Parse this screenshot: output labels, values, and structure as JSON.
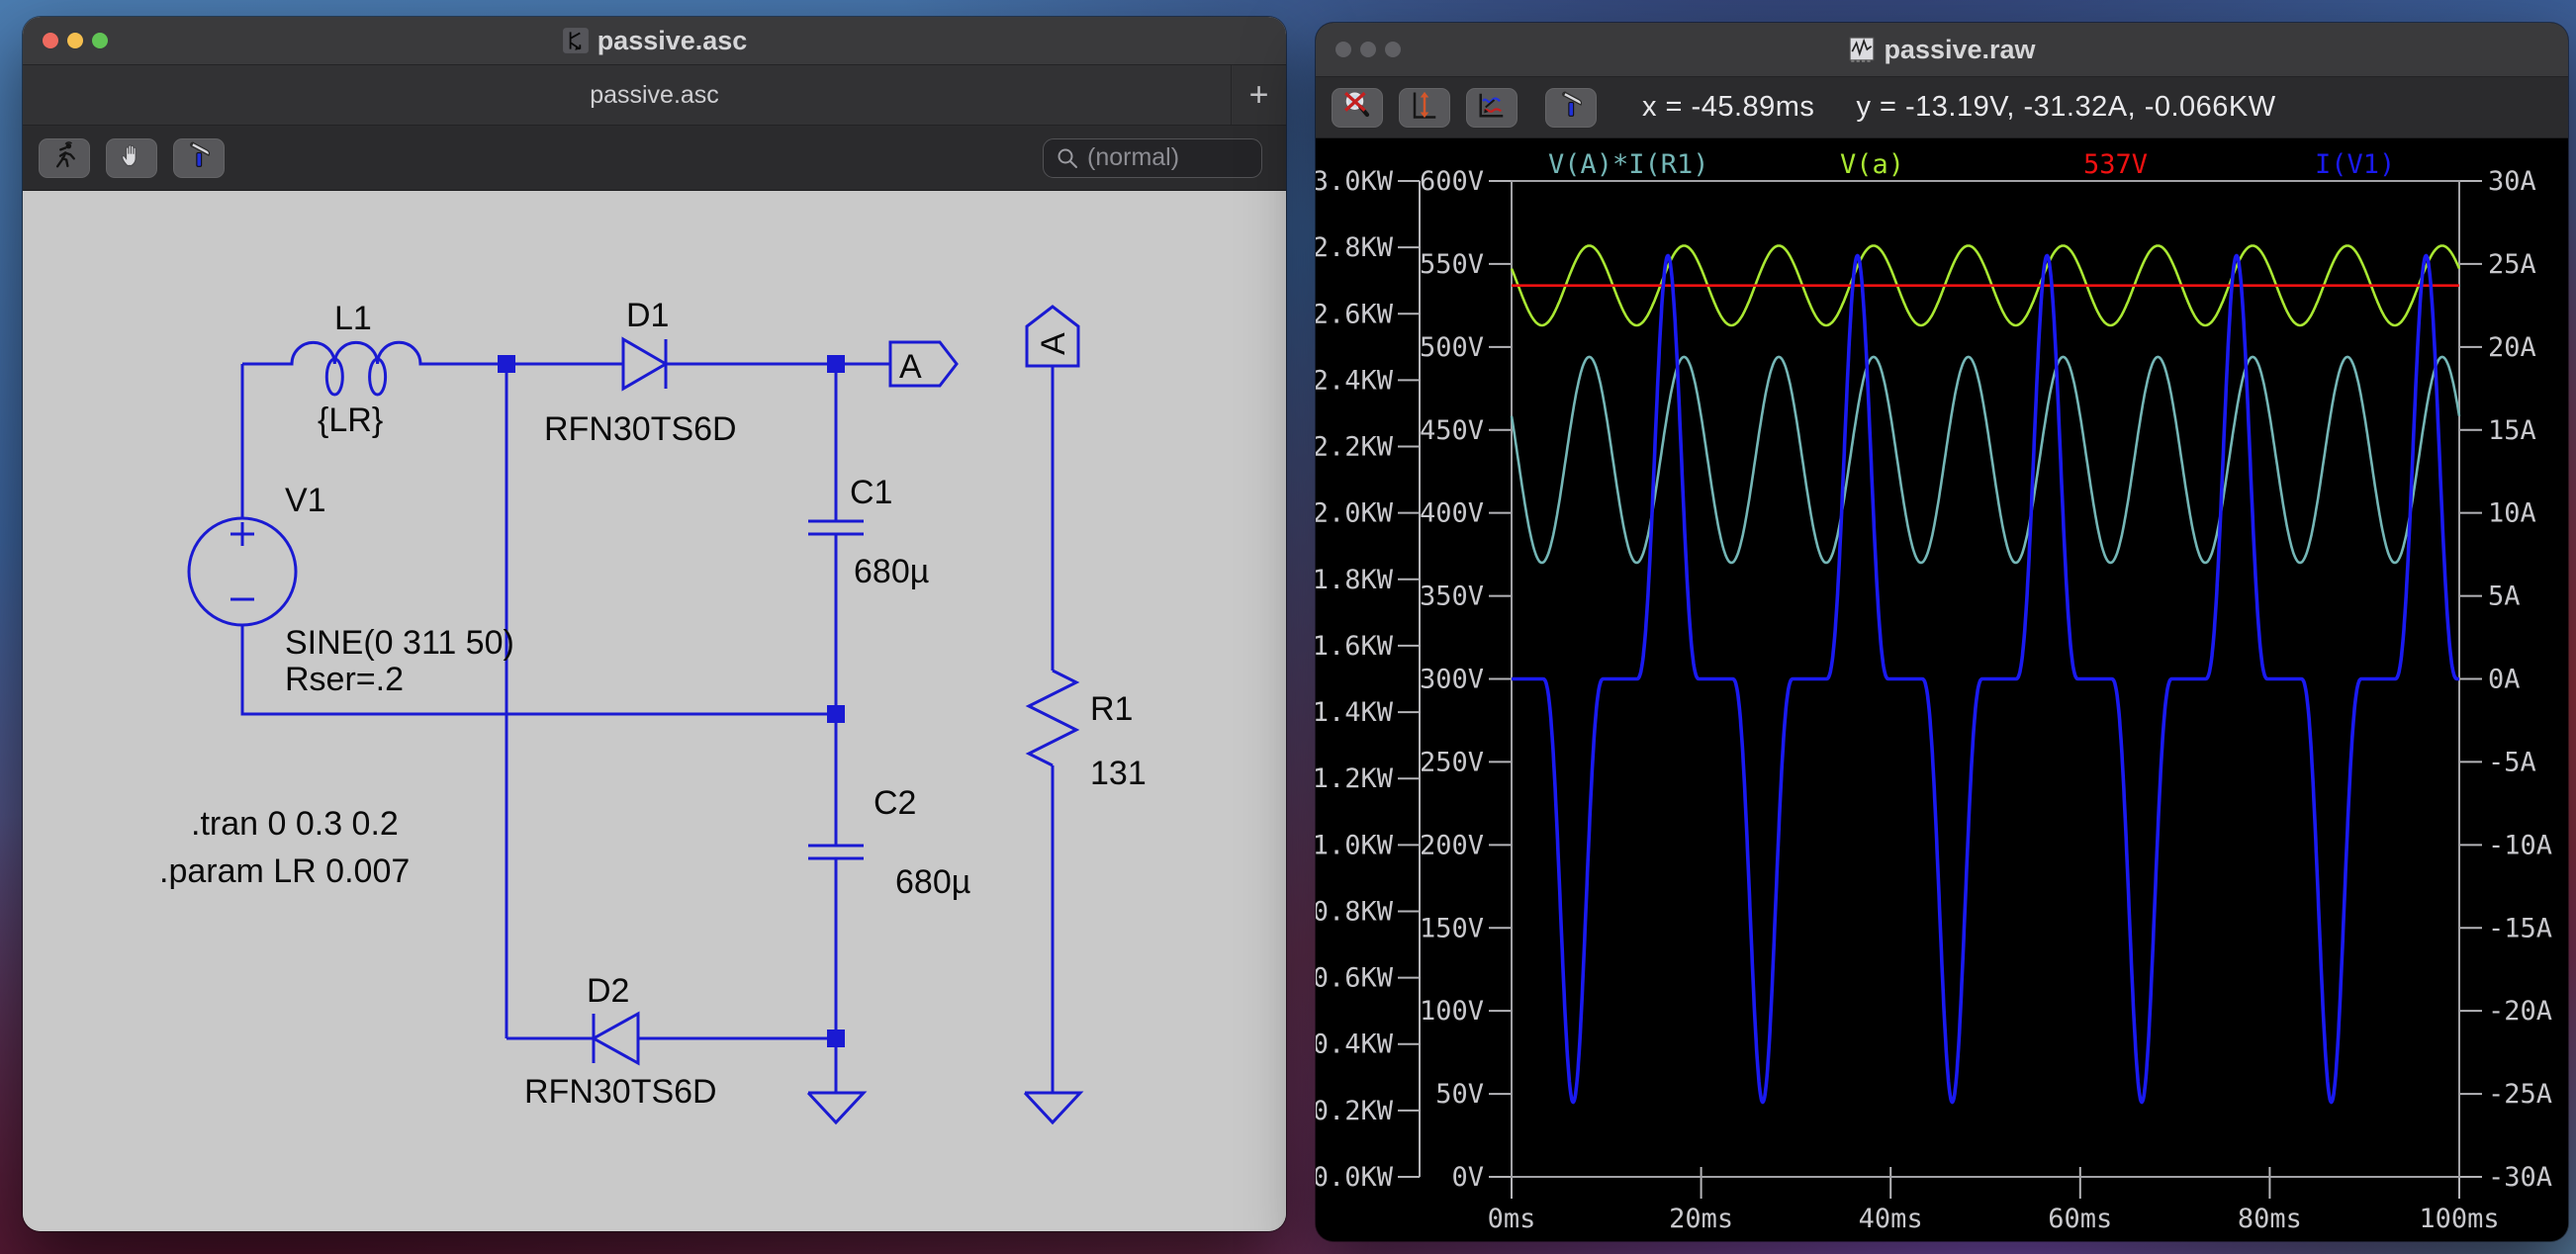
{
  "desktop": {
    "wallpaper_colors": [
      "#4b7cb0",
      "#3c639c",
      "#93333c",
      "#7e58c8",
      "#4a0f26",
      "#4f7d9c"
    ]
  },
  "left_window": {
    "title": "passive.asc",
    "tab_label": "passive.asc",
    "new_tab_label": "+",
    "toolbar": {
      "icons": [
        "run-icon",
        "pan-hand-icon",
        "tools-hammer-icon"
      ],
      "search_placeholder": "(normal)"
    },
    "schematic": {
      "wire_color": "#1a1ad2",
      "components": {
        "l1": {
          "ref": "L1",
          "value": "{LR}"
        },
        "d1": {
          "ref": "D1",
          "model": "RFN30TS6D"
        },
        "v1": {
          "ref": "V1",
          "value": "SINE(0 311 50)",
          "rser": "Rser=.2"
        },
        "c1": {
          "ref": "C1",
          "value": "680µ"
        },
        "c2": {
          "ref": "C2",
          "value": "680µ"
        },
        "d2": {
          "ref": "D2",
          "model": "RFN30TS6D"
        },
        "r1": {
          "ref": "R1",
          "value": "131"
        }
      },
      "net_flags": {
        "out": "A",
        "load": "A"
      },
      "directives": {
        "tran": ".tran 0 0.3 0.2",
        "param": ".param LR 0.007"
      }
    }
  },
  "right_window": {
    "title": "passive.raw",
    "toolbar": {
      "icons": [
        "zoom-cancel-icon",
        "autorange-icon",
        "plot-settings-icon",
        "tools-hammer-icon"
      ],
      "cursor_x": "x = -45.89ms",
      "cursor_y": "y = -13.19V, -31.32A, -0.066KW"
    }
  },
  "chart_data": {
    "type": "line",
    "title": "",
    "background": "#000000",
    "axis_color": "#c8c8cc",
    "tick_color": "#b4b4b8",
    "grid": false,
    "legend_position": "top",
    "x_axis": {
      "unit": "ms",
      "range": [
        0,
        100
      ],
      "tick_values": [
        0,
        20,
        40,
        60,
        80,
        100
      ],
      "tick_labels": [
        "0ms",
        "20ms",
        "40ms",
        "60ms",
        "80ms",
        "100ms"
      ]
    },
    "y_axes": {
      "power": {
        "side": "outer-left",
        "unit": "KW",
        "range": [
          0,
          3
        ],
        "tick_labels": [
          "3.0KW",
          "2.8KW",
          "2.6KW",
          "2.4KW",
          "2.2KW",
          "2.0KW",
          "1.8KW",
          "1.6KW",
          "1.4KW",
          "1.2KW",
          "1.0KW",
          "0.8KW",
          "0.6KW",
          "0.4KW",
          "0.2KW",
          "0.0KW"
        ]
      },
      "voltage": {
        "side": "left",
        "unit": "V",
        "range": [
          0,
          600
        ],
        "tick_labels": [
          "600V",
          "550V",
          "500V",
          "450V",
          "400V",
          "350V",
          "300V",
          "250V",
          "200V",
          "150V",
          "100V",
          "50V",
          "0V"
        ]
      },
      "current": {
        "side": "right",
        "unit": "A",
        "range": [
          -30,
          30
        ],
        "tick_labels": [
          "30A",
          "25A",
          "20A",
          "15A",
          "10A",
          "5A",
          "0A",
          "-5A",
          "-10A",
          "-15A",
          "-20A",
          "-25A",
          "-30A"
        ]
      }
    },
    "series": [
      {
        "name": "V(A)*I(R1)",
        "axis": "power",
        "color": "#74b6b6",
        "model": {
          "kind": "sine",
          "mean": 2.16,
          "amplitude": 0.31,
          "period_ms": 10,
          "peak_at_ms": 8.2
        }
      },
      {
        "name": "V(a)",
        "axis": "voltage",
        "color": "#a9e832",
        "model": {
          "kind": "sine",
          "mean": 537,
          "amplitude": 24,
          "period_ms": 10,
          "peak_at_ms": 8.2
        }
      },
      {
        "name": "537V",
        "axis": "voltage",
        "color": "#ef1111",
        "model": {
          "kind": "constant",
          "value": 537
        }
      },
      {
        "name": "I(V1)",
        "axis": "current",
        "color": "#1a1af0",
        "model": {
          "kind": "pulse_train",
          "baseline": 0,
          "period_ms": 20,
          "shape_exponent": 1.3,
          "pulses": [
            {
              "center_ms": 6.5,
              "peak": -25.5,
              "half_width_ms": 3.2
            },
            {
              "center_ms": 16.5,
              "peak": 25.5,
              "half_width_ms": 3.3
            }
          ]
        }
      }
    ]
  }
}
